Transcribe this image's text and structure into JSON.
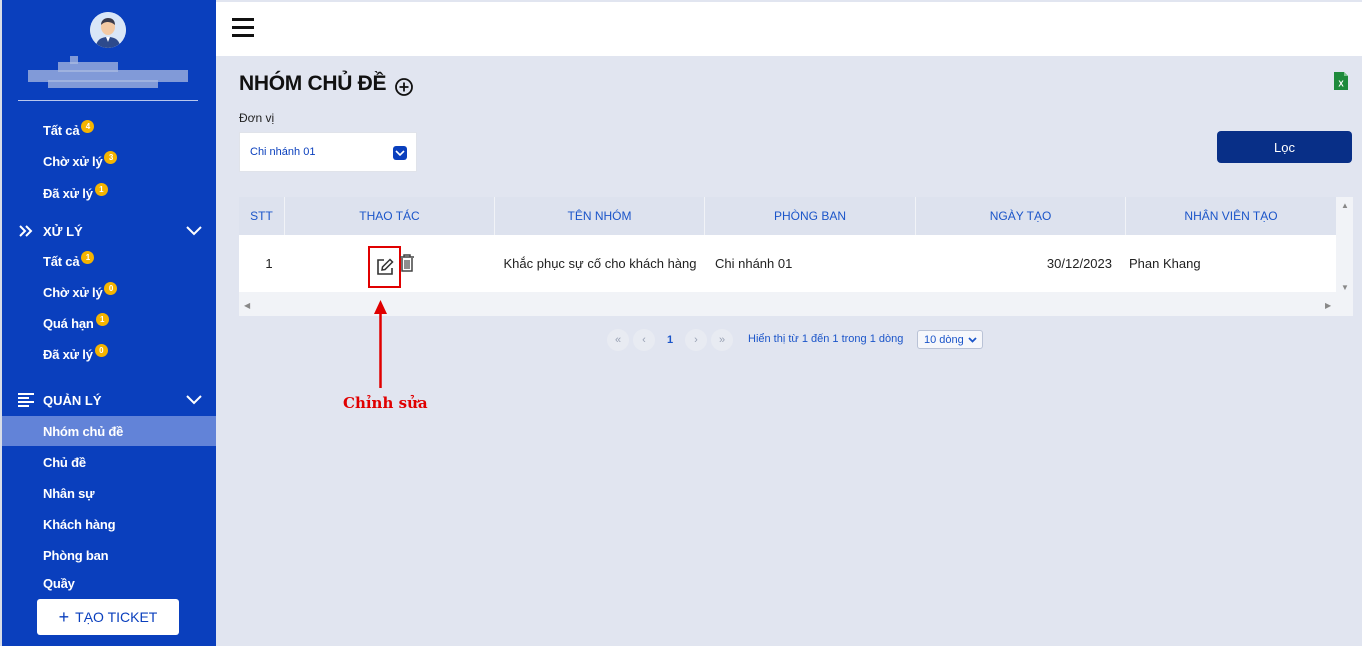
{
  "sidebar": {
    "top_items": [
      {
        "label": "Tất cả",
        "badge": "4"
      },
      {
        "label": "Chờ xử lý",
        "badge": "3"
      },
      {
        "label": "Đã xử lý",
        "badge": "1"
      }
    ],
    "section_xuly": {
      "label": "XỬ LÝ",
      "items": [
        {
          "label": "Tất cả",
          "badge": "1"
        },
        {
          "label": "Chờ xử lý",
          "badge": "0"
        },
        {
          "label": "Quá hạn",
          "badge": "1"
        },
        {
          "label": "Đã xử lý",
          "badge": "0"
        }
      ]
    },
    "section_quanly": {
      "label": "QUẢN LÝ",
      "items": [
        {
          "label": "Nhóm chủ đề"
        },
        {
          "label": "Chủ đề"
        },
        {
          "label": "Nhân sự"
        },
        {
          "label": "Khách hàng"
        },
        {
          "label": "Phòng ban"
        },
        {
          "label": "Quầy"
        }
      ]
    },
    "create_ticket_label": "TẠO TICKET"
  },
  "page": {
    "title": "NHÓM CHỦ ĐỀ"
  },
  "filter": {
    "label": "Đơn vị",
    "selected": "Chi nhánh 01",
    "button_label": "Lọc"
  },
  "table": {
    "headers": [
      "STT",
      "THAO TÁC",
      "TÊN NHÓM",
      "PHÒNG BAN",
      "NGÀY TẠO",
      "NHÂN VIÊN TẠO"
    ],
    "rows": [
      {
        "stt": "1",
        "name": "Khắc phục sự cố cho khách hàng",
        "department": "Chi nhánh 01",
        "created": "30/12/2023",
        "creator": "Phan Khang"
      }
    ]
  },
  "pagination": {
    "current": "1",
    "info": "Hiển thị từ 1 đến 1 trong 1 dòng",
    "page_size": "10 dòng"
  },
  "annotation": {
    "label": "Chỉnh sửa",
    "color": "#e00000"
  },
  "colors": {
    "sidebar": "#0a3fbd",
    "active_item": "#6283d8",
    "primary_button": "#082f87",
    "badge": "#f5b400"
  }
}
